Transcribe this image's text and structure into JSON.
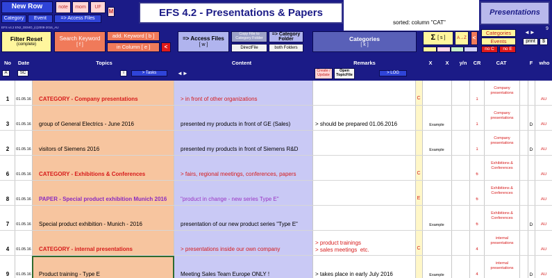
{
  "toolbar": {
    "new_row": "New Row",
    "category": "Category",
    "event": "Event",
    "access_files_small": "=> Access Files",
    "note": "note",
    "mom": "mom",
    "uf": "UF",
    "m": "M",
    "title": "EFS 4.2  -  Presentations & Papers",
    "sorted": "sorted: column \"CAT\"",
    "presentations": "Presentations",
    "page_num": "9",
    "filter_reset": "Filter Reset",
    "filter_reset_sub": "(complete)",
    "search_keyword": "Search Keyword",
    "search_keyword_key": "[ f ]",
    "add_keyword": "add. Keyword  [ b ]",
    "in_column": "in Column  [ e ]",
    "lt_btn": "<",
    "access_files": "=> Access Files",
    "access_files_key": "[ w ]",
    "copy_file": "Copy File to Category Folder",
    "direct_file": "DirectFile",
    "to_category": "=> Category Folder",
    "both_folders": "both Folders",
    "categories_btn": "Categories",
    "categories_key": "[ k ]",
    "sigma": "Σ",
    "sigma_key": "[ s ]",
    "sort_az": "A→Z",
    "categories_side": "Categories",
    "events_side": "Events",
    "no_c": "no  C",
    "no_e": "no  E",
    "print": "print",
    "count": "$",
    "file_path": "EFS v4.2 EN2_DEMO_(c)2008-2016_AU"
  },
  "header": {
    "no": "No",
    "date": "Date",
    "topics": "Topics",
    "content": "Content",
    "remarks": "Remarks",
    "x1": "X",
    "x2": "X",
    "yn": "y/n",
    "cr": "CR",
    "cat": "CAT",
    "f": "F",
    "who": "who",
    "a": "A",
    "sc": "SC",
    "i": "i",
    "tasks": ">  Tasks",
    "resize": "◄►",
    "create_update": "Create / Update",
    "open_topicfile": "Open TopicFile",
    "log": ">  LOG"
  },
  "rows": [
    {
      "no": "1",
      "date": "01.05.16",
      "topic": "CATEGORY - Company presentations",
      "content": ">  in front of other organizations",
      "remarks": "",
      "x1": "C",
      "x2": "",
      "cr": "1",
      "cat": "Company presentations",
      "f": "",
      "who": "AU",
      "style": "cat"
    },
    {
      "no": "3",
      "date": "01.05.16",
      "topic": "group of General Electrics - June 2016",
      "content": "presented my products in front of GE (Sales)",
      "remarks": "> should be prepared 01.06.2016",
      "x1": "",
      "x2": "Example",
      "cr": "1",
      "cat": "Company presentations",
      "f": "D",
      "who": "AU",
      "style": "normal"
    },
    {
      "no": "2",
      "date": "01.05.16",
      "topic": "visitors of Siemens 2016",
      "content": "presented my products in front of Siemens R&D",
      "remarks": "",
      "x1": "",
      "x2": "Example",
      "cr": "1",
      "cat": "Company presentations",
      "f": "D",
      "who": "AU",
      "style": "normal"
    },
    {
      "no": "6",
      "date": "01.05.16",
      "topic": "CATEGORY - Exhibitions & Conferences",
      "content": "> fairs, regional meetings, conferences, papers",
      "remarks": "",
      "x1": "C",
      "x2": "",
      "cr": "6",
      "cat": "Exhibitions & Conferences",
      "f": "",
      "who": "AU",
      "style": "cat"
    },
    {
      "no": "8",
      "date": "01.05.16",
      "topic": "PAPER - Special product exhibition Munich 2016",
      "content": "\"product in change - new series Type E\"",
      "remarks": "",
      "x1": "E",
      "x2": "",
      "cr": "6",
      "cat": "Exhibitions & Conferences",
      "f": "",
      "who": "AU",
      "style": "paper"
    },
    {
      "no": "7",
      "date": "01.05.16",
      "topic": "Special product exhibition - Munich - 2016",
      "content": "presentation of our new product series \"Type E\"",
      "remarks": "",
      "x1": "",
      "x2": "Example",
      "cr": "6",
      "cat": "Exhibitions & Conferences",
      "f": "D",
      "who": "AU",
      "style": "normal"
    },
    {
      "no": "4",
      "date": "01.05.16",
      "topic": "CATEGORY - internal presentations",
      "content": "> presentations inside our own company",
      "remarks": "> product trainings\n> sales meetings  etc.",
      "x1": "C",
      "x2": "",
      "cr": "4",
      "cat": "internal presentations",
      "f": "",
      "who": "AU",
      "style": "cat"
    },
    {
      "no": "9",
      "date": "01.05.16",
      "topic": "Product training - Type E",
      "content": "Meeting Sales Team Europe ONLY !",
      "remarks": "> takes place in early July 2016",
      "x1": "",
      "x2": "Example",
      "cr": "4",
      "cat": "internal presentations",
      "f": "D",
      "who": "AU",
      "style": "normal"
    }
  ],
  "colors": {
    "toolbar_bg": "#1b1b87",
    "topic_col": "#f7c59f",
    "content_col": "#c9c9f5",
    "category_red": "#d61a1a",
    "paper_purple": "#8a2ac0",
    "content_cat_purple": "#9a33c4"
  }
}
